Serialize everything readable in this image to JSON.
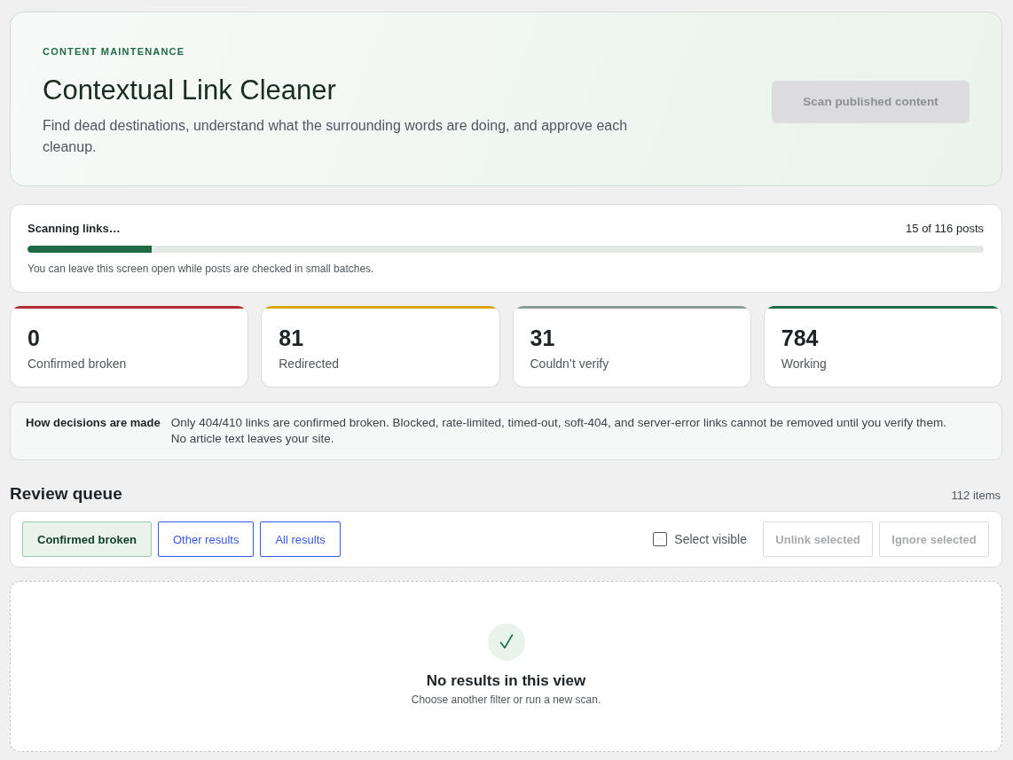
{
  "hero": {
    "eyebrow": "CONTENT MAINTENANCE",
    "title": "Contextual Link Cleaner",
    "description": "Find dead destinations, understand what the surrounding words are doing, and approve each cleanup.",
    "scan_button": {
      "label": "Scan published content",
      "disabled": true
    }
  },
  "progress": {
    "label": "Scanning links…",
    "count": "15 of 116 posts",
    "level": 0.13,
    "note": "You can leave this screen open while posts are checked in small batches."
  },
  "stats": [
    {
      "value": "0",
      "label": "Confirmed broken",
      "color": "#b32d2e"
    },
    {
      "value": "81",
      "label": "Redirected",
      "color": "#dba617"
    },
    {
      "value": "31",
      "label": "Couldn’t verify",
      "color": "#8c9b95"
    },
    {
      "value": "784",
      "label": "Working",
      "color": "#1e6b45"
    }
  ],
  "info": {
    "heading": "How decisions are made",
    "text": "Only 404/410 links are confirmed broken. Blocked, rate-limited, timed-out, soft-404, and server-error links cannot be removed until you verify them. No article text leaves your site."
  },
  "review_queue": {
    "title": "Review queue",
    "count": "112 items",
    "filters": [
      {
        "label": "Confirmed broken",
        "selected": true
      },
      {
        "label": "Other results",
        "selected": false
      },
      {
        "label": "All results",
        "selected": false
      }
    ],
    "select_visible": {
      "label": "Select visible",
      "checked": false
    },
    "actions": [
      {
        "label": "Unlink selected",
        "disabled": true
      },
      {
        "label": "Ignore selected",
        "disabled": true
      }
    ],
    "empty_state": {
      "title": "No results in this view",
      "text": "Choose another filter or run a new scan."
    }
  }
}
